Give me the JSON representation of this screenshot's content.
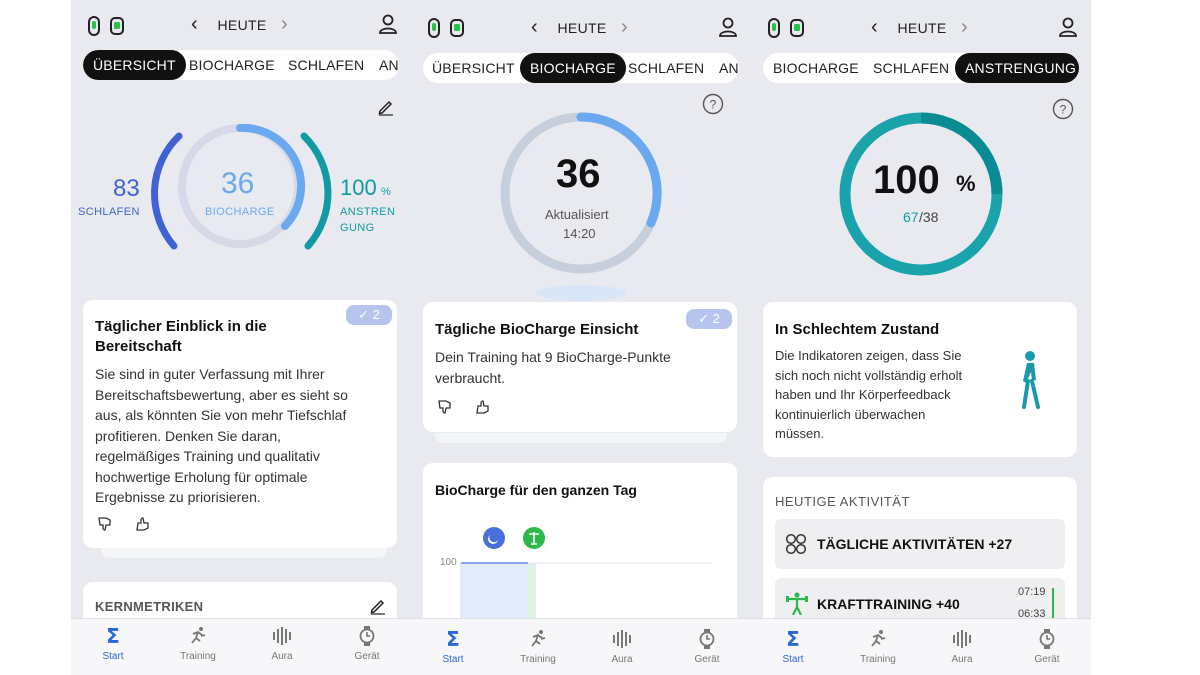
{
  "nav": {
    "date": "HEUTE",
    "prev": "‹",
    "next": "›"
  },
  "screen1": {
    "tabs": [
      "ÜBERSICHT",
      "BIOCHARGE",
      "SCHLAFEN",
      "AN"
    ],
    "gauge": {
      "sleep_value": "83",
      "sleep_label": "SCHLAFEN",
      "biocharge_value": "36",
      "biocharge_label": "BIOCHARGE",
      "strain_value": "100",
      "strain_unit": "%",
      "strain_label_1": "ANSTREN",
      "strain_label_2": "GUNG"
    },
    "card": {
      "title_1": "Täglicher Einblick in die",
      "title_2": "Bereitschaft",
      "badge": "✓ 2",
      "body": [
        "Sie sind in guter Verfassung mit Ihrer",
        "Bereitschaftsbewertung, aber es sieht so",
        "aus, als könnten Sie von mehr Tiefschlaf",
        "profitieren. Denken Sie daran,",
        "regelmäßiges Training und qualitativ",
        "hochwertige Erholung für optimale",
        "Ergebnisse zu priorisieren."
      ]
    },
    "core_metrics": "KERNMETRIKEN"
  },
  "screen2": {
    "tabs": [
      "ÜBERSICHT",
      "BIOCHARGE",
      "SCHLAFEN",
      "AN"
    ],
    "gauge": {
      "value": "36",
      "updated_label": "Aktualisiert",
      "updated_time": "14:20"
    },
    "card": {
      "title": "Tägliche BioCharge Einsicht",
      "badge": "✓ 2",
      "body": [
        "Dein Training hat 9 BioCharge-Punkte",
        "verbraucht."
      ]
    },
    "chart_card": {
      "title": "BioCharge für den ganzen Tag",
      "y_tick": "100"
    }
  },
  "screen3": {
    "tabs": [
      "BIOCHARGE",
      "SCHLAFEN",
      "ANSTRENGUNG"
    ],
    "gauge": {
      "value": "100",
      "unit": "%",
      "sub_value": "67",
      "sub_total": "/38"
    },
    "card": {
      "title": "In Schlechtem Zustand",
      "body": [
        "Die Indikatoren zeigen, dass Sie",
        "sich noch nicht vollständig erholt",
        "haben und Ihr Körperfeedback",
        "kontinuierlich überwachen",
        "müssen."
      ]
    },
    "activity": {
      "heading": "HEUTIGE AKTIVITÄT",
      "daily": "TÄGLICHE AKTIVITÄTEN +27",
      "strength": "KRAFTTRAINING +40",
      "time_start": "07:19",
      "time_end": "06:33"
    }
  },
  "bottom_nav": [
    {
      "label": "Start",
      "icon": "sigma-icon"
    },
    {
      "label": "Training",
      "icon": "running-icon"
    },
    {
      "label": "Aura",
      "icon": "aura-icon"
    },
    {
      "label": "Gerät",
      "icon": "watch-icon"
    }
  ],
  "colors": {
    "accent_blue": "#2a67d8",
    "biocharge_light": "#6aa9f0",
    "teal": "#119aa4",
    "dark_blue": "#3f63d3",
    "badge": "#b7c4ee"
  }
}
